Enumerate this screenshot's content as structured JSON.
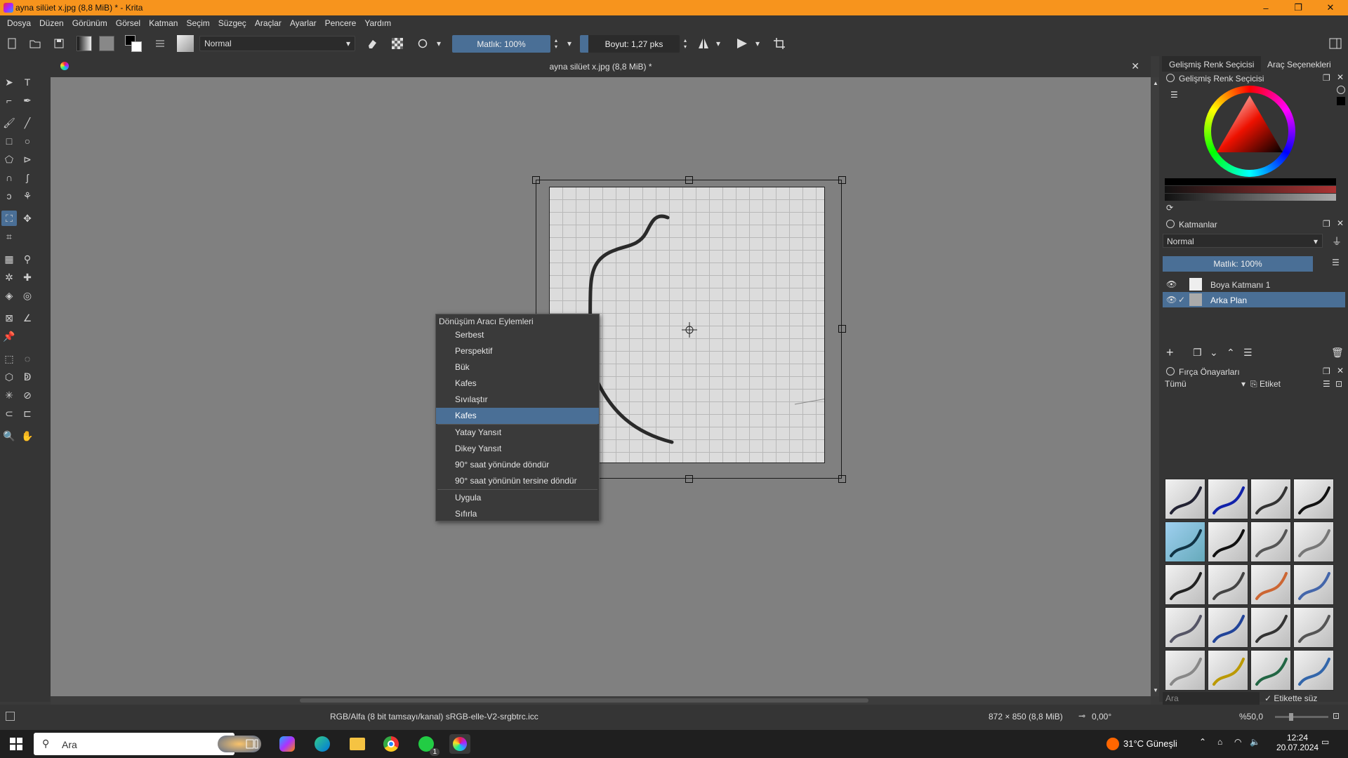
{
  "window": {
    "title": "ayna silüet x.jpg (8,8 MiB) * - Krita",
    "minimize": "–",
    "maximize": "❐",
    "close": "✕"
  },
  "menu": [
    "Dosya",
    "Düzen",
    "Görünüm",
    "Görsel",
    "Katman",
    "Seçim",
    "Süzgeç",
    "Araçlar",
    "Ayarlar",
    "Pencere",
    "Yardım"
  ],
  "toolbar": {
    "blend_mode": "Normal",
    "opacity": "Matlık: 100%",
    "size": "Boyut: 1,27 pks"
  },
  "document": {
    "tab_title": "ayna silüet x.jpg (8,8 MiB) *",
    "close": "✕"
  },
  "context_menu": {
    "header": "Dönüşüm Aracı Eylemleri",
    "items": [
      {
        "label": "Serbest"
      },
      {
        "label": "Perspektif"
      },
      {
        "label": "Bük"
      },
      {
        "label": "Kafes"
      },
      {
        "label": "Sıvılaştır"
      },
      {
        "label": "Kafes",
        "selected": true
      },
      {
        "label": "Yatay Yansıt"
      },
      {
        "label": "Dikey Yansıt"
      },
      {
        "label": "90° saat yönünde döndür"
      },
      {
        "label": "90° saat yönünün tersine döndür"
      },
      {
        "label": "Uygula"
      },
      {
        "label": "Sıfırla"
      }
    ]
  },
  "dock": {
    "tabs": [
      "Gelişmiş Renk Seçicisi",
      "Araç Seçenekleri"
    ],
    "color_panel_title": "Gelişmiş Renk Seçicisi",
    "layers_title": "Katmanlar",
    "layers_blend": "Normal",
    "layers_opacity": "Matlık: 100%",
    "layers": [
      {
        "name": "Boya Katmanı 1",
        "active": false
      },
      {
        "name": "Arka Plan",
        "active": true
      }
    ],
    "brush_title": "Fırça Önayarları",
    "brush_filter": "Tümü",
    "brush_tag": "Etiket",
    "brush_search_placeholder": "Ara",
    "brush_tag_filter": "Etikette süz"
  },
  "status": {
    "color_profile": "RGB/Alfa (8 bit tamsayı/kanal) sRGB-elle-V2-srgbtrc.icc",
    "dimensions": "872 × 850 (8,8 MiB)",
    "rotation": "0,00°",
    "zoom": "%50,0"
  },
  "taskbar": {
    "search": "Ara",
    "weather": "31°C  Güneşli",
    "time": "12:24",
    "date": "20.07.2024",
    "whatsapp_badge": "1"
  },
  "colors": {
    "titlebar": "#f7941d",
    "accent": "#4a6f96",
    "panel": "#353535",
    "canvas": "#808080"
  }
}
